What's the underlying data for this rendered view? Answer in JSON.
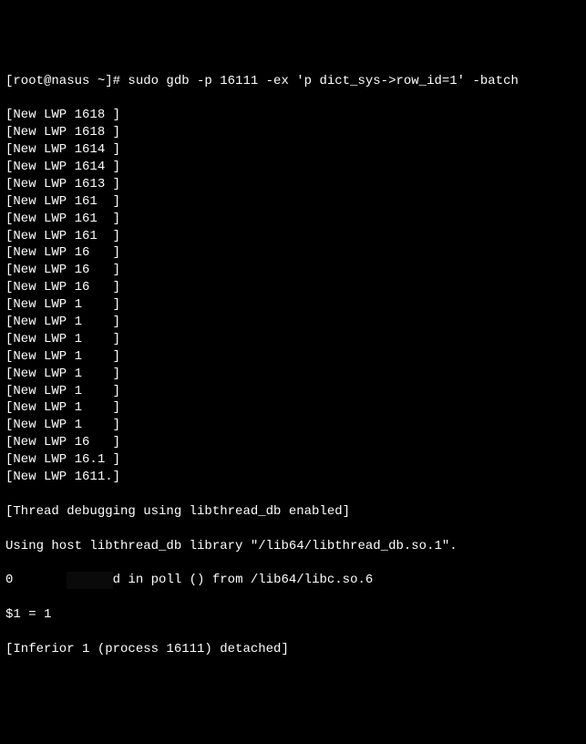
{
  "terminal": {
    "prompt": "[root@nasus ~]# ",
    "command": "sudo gdb -p 16111 -ex 'p dict_sys->row_id=1' -batch",
    "lwp_prefix": "[New LWP ",
    "lwp_suffix": "]",
    "lwp_lines": [
      "1618 ",
      "1618 ",
      "1614 ",
      "1614 ",
      "1613 ",
      "161  ",
      "161  ",
      "161  ",
      "16   ",
      "16   ",
      "16   ",
      "1    ",
      "1    ",
      "1    ",
      "1    ",
      "1    ",
      "1    ",
      "1    ",
      "1    ",
      "16   ",
      "16.1 ",
      "1611."
    ],
    "thread_debug": "[Thread debugging using libthread_db enabled]",
    "using_host": "Using host libthread_db library \"/lib64/libthread_db.so.1\".",
    "poll_line_prefix": "0       ",
    "poll_line_mid": "      ",
    "poll_line_suffix": "d in poll () from /lib64/libc.so.6",
    "result": "$1 = 1",
    "inferior": "[Inferior 1 (process 16111) detached]"
  }
}
